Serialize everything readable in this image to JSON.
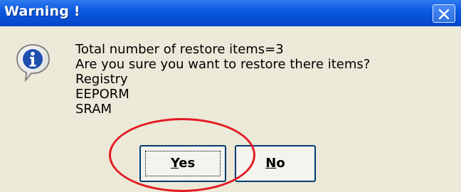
{
  "window": {
    "title": "Warning !",
    "close_icon": "close-icon"
  },
  "dialog": {
    "icon": "info-icon",
    "lines": [
      "Total number of restore items=3",
      "Are you sure you want to restore there items?",
      "Registry",
      "EEPORM",
      "SRAM"
    ]
  },
  "buttons": {
    "yes": {
      "mnemonic": "Y",
      "rest": "es"
    },
    "no": {
      "mnemonic": "N",
      "rest": "o"
    }
  },
  "annotation": {
    "type": "red-circle",
    "highlights": "yes-button",
    "color": "#e31b23"
  },
  "colors": {
    "titlebar": "#0a5be0",
    "dialog_bg": "#ece9d8",
    "button_border": "#003c74"
  }
}
